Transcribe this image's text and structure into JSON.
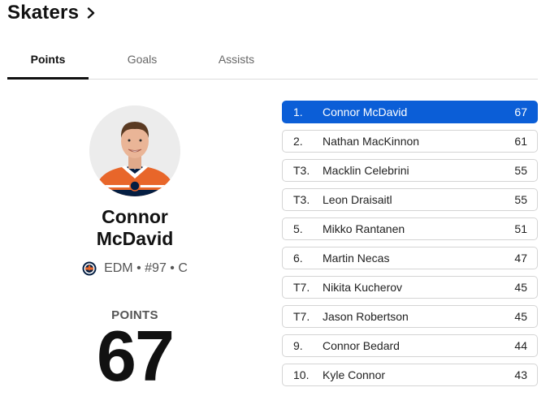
{
  "header": {
    "title": "Skaters"
  },
  "tabs": [
    {
      "label": "Points",
      "active": true
    },
    {
      "label": "Goals",
      "active": false
    },
    {
      "label": "Assists",
      "active": false
    }
  ],
  "featured": {
    "first_name": "Connor",
    "last_name": "McDavid",
    "team": "EDM",
    "number": "#97",
    "position": "C",
    "stat_label": "POINTS",
    "stat_value": "67",
    "team_logo_icon": "oilers-logo-icon"
  },
  "leaders": [
    {
      "rank": "1.",
      "name": "Connor McDavid",
      "value": "67",
      "selected": true
    },
    {
      "rank": "2.",
      "name": "Nathan MacKinnon",
      "value": "61"
    },
    {
      "rank": "T3.",
      "name": "Macklin Celebrini",
      "value": "55"
    },
    {
      "rank": "T3.",
      "name": "Leon Draisaitl",
      "value": "55"
    },
    {
      "rank": "5.",
      "name": "Mikko Rantanen",
      "value": "51"
    },
    {
      "rank": "6.",
      "name": "Martin Necas",
      "value": "47"
    },
    {
      "rank": "T7.",
      "name": "Nikita Kucherov",
      "value": "45"
    },
    {
      "rank": "T7.",
      "name": "Jason Robertson",
      "value": "45"
    },
    {
      "rank": "9.",
      "name": "Connor Bedard",
      "value": "44"
    },
    {
      "rank": "10.",
      "name": "Kyle Connor",
      "value": "43"
    }
  ],
  "colors": {
    "accent": "#0b5ed7",
    "oilers_orange": "#e8662a",
    "oilers_blue": "#041e42"
  }
}
